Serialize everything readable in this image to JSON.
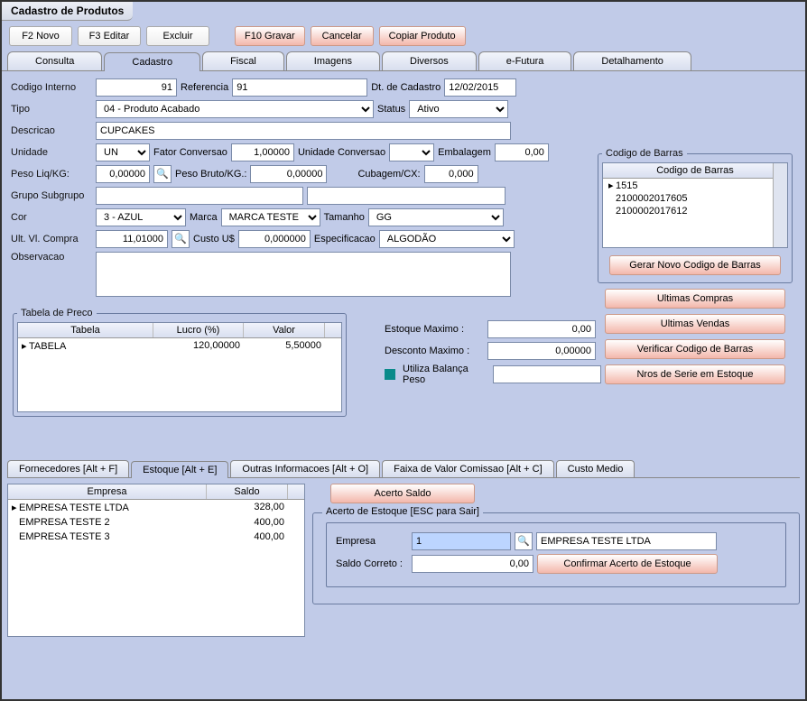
{
  "window": {
    "title": "Cadastro de Produtos"
  },
  "toolbar": {
    "f2_novo": "F2 Novo",
    "f3_editar": "F3 Editar",
    "excluir": "Excluir",
    "f10_gravar": "F10 Gravar",
    "cancelar": "Cancelar",
    "copiar_produto": "Copiar Produto"
  },
  "maintabs": {
    "consulta": "Consulta",
    "cadastro": "Cadastro",
    "fiscal": "Fiscal",
    "imagens": "Imagens",
    "diversos": "Diversos",
    "efutura": "e-Futura",
    "detalhamento": "Detalhamento"
  },
  "form": {
    "codigo_interno_lbl": "Codigo Interno",
    "codigo_interno": "91",
    "referencia_lbl": "Referencia",
    "referencia": "91",
    "dt_cadastro_lbl": "Dt. de Cadastro",
    "dt_cadastro": "12/02/2015",
    "tipo_lbl": "Tipo",
    "tipo": "04 - Produto Acabado",
    "status_lbl": "Status",
    "status": "Ativo",
    "descricao_lbl": "Descricao",
    "descricao": "CUPCAKES",
    "unidade_lbl": "Unidade",
    "unidade": "UN",
    "fator_conv_lbl": "Fator Conversao",
    "fator_conv": "1,00000",
    "unid_conv_lbl": "Unidade Conversao",
    "unid_conv": "",
    "embalagem_lbl": "Embalagem",
    "embalagem": "0,00",
    "peso_liq_lbl": "Peso Liq/KG:",
    "peso_liq": "0,00000",
    "peso_bruto_lbl": "Peso Bruto/KG.:",
    "peso_bruto": "0,00000",
    "cubagem_lbl": "Cubagem/CX:",
    "cubagem": "0,000",
    "grupo_lbl": "Grupo Subgrupo",
    "grupo": "",
    "subgrupo": "",
    "cor_lbl": "Cor",
    "cor": "3 - AZUL",
    "marca_lbl": "Marca",
    "marca": "MARCA TESTE",
    "tamanho_lbl": "Tamanho",
    "tamanho": "GG",
    "ult_vl_compra_lbl": "Ult. Vl. Compra",
    "ult_vl_compra": "11,01000",
    "custo_us_lbl": "Custo U$",
    "custo_us": "0,000000",
    "especificacao_lbl": "Especificacao",
    "especificacao": "ALGODÃO",
    "observacao_lbl": "Observacao",
    "observacao": ""
  },
  "barcodes": {
    "legend": "Codigo de Barras",
    "header": "Codigo de Barras",
    "items": [
      "1515",
      "2100002017605",
      "2100002017612"
    ],
    "gerar": "Gerar Novo Codigo de Barras"
  },
  "sidebtns": {
    "ult_compras": "Ultimas Compras",
    "ult_vendas": "Ultimas Vendas",
    "verificar": "Verificar Codigo de Barras",
    "nros_serie": "Nros de Serie em Estoque"
  },
  "tabela": {
    "legend": "Tabela de Preco",
    "hdr_tabela": "Tabela",
    "hdr_lucro": "Lucro (%)",
    "hdr_valor": "Valor",
    "row_tabela": "TABELA",
    "row_lucro": "120,00000",
    "row_valor": "5,50000"
  },
  "estoque_info": {
    "max_lbl": "Estoque Maximo :",
    "max": "0,00",
    "desc_lbl": "Desconto Maximo :",
    "desc": "0,00000",
    "balanca_lbl": "Utiliza Balança Peso",
    "balanca_val": ""
  },
  "btabs": {
    "fornecedores": "Fornecedores [Alt + F]",
    "estoque": "Estoque [Alt + E]",
    "outras": "Outras Informacoes [Alt + O]",
    "faixa": "Faixa de Valor Comissao [Alt + C]",
    "custo_medio": "Custo Medio"
  },
  "empresas": {
    "hdr_empresa": "Empresa",
    "hdr_saldo": "Saldo",
    "rows": [
      {
        "nome": "EMPRESA TESTE LTDA",
        "saldo": "328,00"
      },
      {
        "nome": "EMPRESA TESTE 2",
        "saldo": "400,00"
      },
      {
        "nome": "EMPRESA TESTE 3",
        "saldo": "400,00"
      }
    ]
  },
  "acerto": {
    "btn": "Acerto Saldo",
    "box_title": "Acerto de Estoque [ESC para Sair]",
    "empresa_lbl": "Empresa",
    "empresa_cod": "1",
    "empresa_nome": "EMPRESA TESTE LTDA",
    "saldo_lbl": "Saldo Correto :",
    "saldo": "0,00",
    "confirmar": "Confirmar Acerto de Estoque"
  }
}
